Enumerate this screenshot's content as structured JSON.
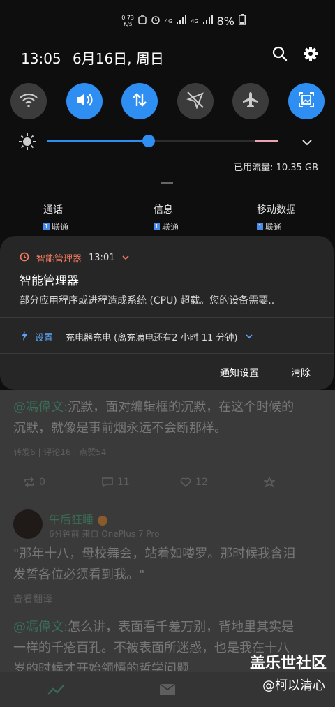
{
  "status_bar": {
    "net_speed": [
      "0.73",
      "K/s"
    ],
    "net_4g_1": "4G",
    "net_4g_2": "4G",
    "battery": "8%"
  },
  "header": {
    "time": "13:05",
    "date": "6月16日, 周日"
  },
  "quick_toggles": [
    {
      "name": "wifi",
      "state": "off"
    },
    {
      "name": "sound",
      "state": "on"
    },
    {
      "name": "mobile-data",
      "state": "on"
    },
    {
      "name": "location",
      "state": "off"
    },
    {
      "name": "airplane",
      "state": "off"
    },
    {
      "name": "screenshot",
      "state": "on"
    }
  ],
  "brightness": {
    "level": 0.44
  },
  "data_usage": "已用流量: 10.35 GB",
  "sim": [
    {
      "label": "通话",
      "badge": "1",
      "carrier": "联通"
    },
    {
      "label": "信息",
      "badge": "1",
      "carrier": "联通"
    },
    {
      "label": "移动数据",
      "badge": "1",
      "carrier": "联通"
    }
  ],
  "notification": {
    "app_name": "智能管理器",
    "time": "13:01",
    "title": "智能管理器",
    "body": "部分应用程序或进程造成系统 (CPU) 超载。您的设备需要..",
    "secondary_app": "设置",
    "secondary_text": "充电器充电 (离充满电还有2 小时 11 分钟)",
    "action_settings": "通知设置",
    "action_clear": "清除"
  },
  "feed": {
    "post1_mention": "@馮偉文:",
    "post1_line1": "沉默，面对编辑框的沉默，在这个时候的",
    "post1_line2": "沉默，就像是事前烟永远不会断那样。",
    "post1_meta": "转发6 | 评论16 | 点赞54",
    "repost_count": "0",
    "comment_count": "11",
    "like_count": "12",
    "user_name": "午后狂睡",
    "user_meta": "6分钟前 来自 OnePlus 7 Pro",
    "post2_line1": "\"那年十八，母校舞会，站着如喽罗。那时候我含泪",
    "post2_line2": "发誓各位必须看到我。\"",
    "translate": "查看翻译",
    "post3_mention": "@馮偉文:",
    "post3_line1": "怎么讲，表面看千差万别，背地里其实是",
    "post3_line2": "一样的千疮百孔。不被表面所迷惑，也是我在十八",
    "post3_line3": "岁的时候才开始领悟的哲学问题"
  },
  "watermark": {
    "line1": "盖乐世社区",
    "line2": "@柯以清心"
  },
  "colors": {
    "accent": "#2e8ef2",
    "app_name": "#f37a5e",
    "toggle_off": "#3b3b3b",
    "card": "#262626"
  }
}
